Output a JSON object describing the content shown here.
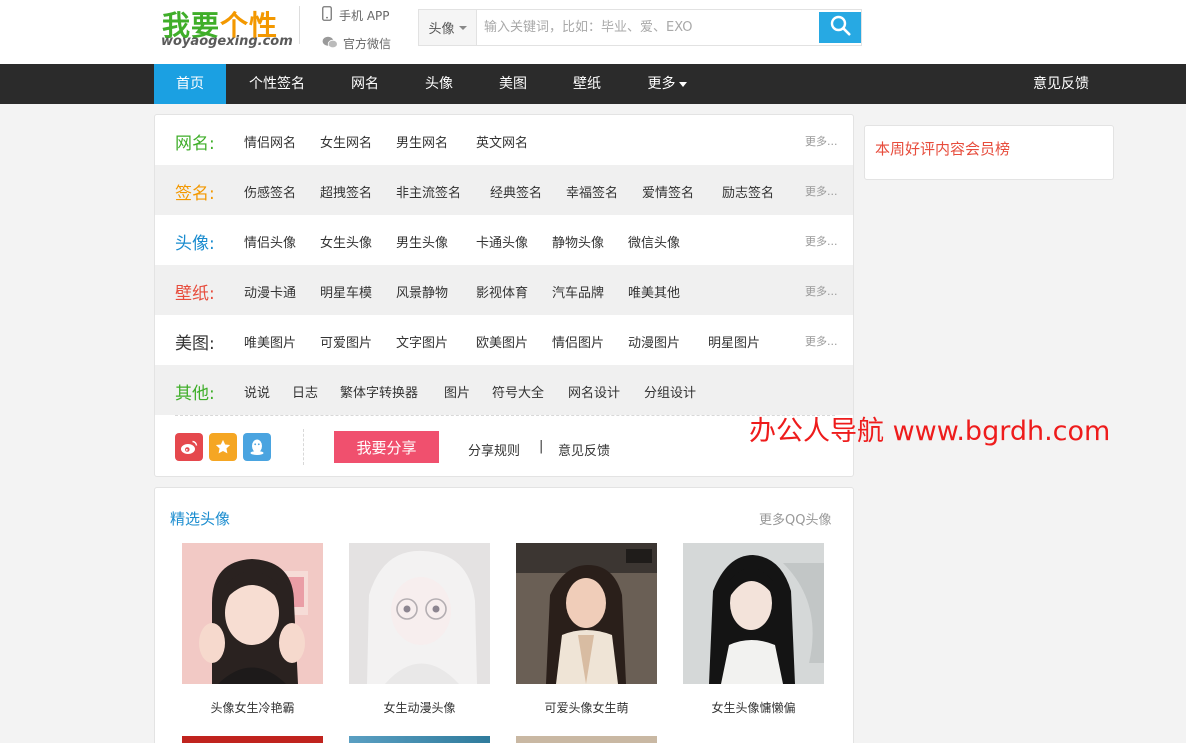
{
  "header": {
    "logo_main_a": "我要",
    "logo_main_b": "个性",
    "logo_sub": "woyaogexing.com",
    "app_link": "手机 APP",
    "wechat_link": "官方微信",
    "search_category": "头像",
    "search_placeholder": "输入关键词，比如：毕业、爱、EXO"
  },
  "nav": {
    "items": [
      {
        "label": "首页"
      },
      {
        "label": "个性签名"
      },
      {
        "label": "网名"
      },
      {
        "label": "头像"
      },
      {
        "label": "美图"
      },
      {
        "label": "壁纸"
      },
      {
        "label": "更多"
      }
    ],
    "feedback": "意见反馈"
  },
  "categories": [
    {
      "title": "网名:",
      "color": "#3fae29",
      "links": [
        "情侣网名",
        "女生网名",
        "男生网名",
        "英文网名"
      ],
      "more": "更多..."
    },
    {
      "title": "签名:",
      "color": "#f39800",
      "links": [
        "伤感签名",
        "超拽签名",
        "非主流签名",
        "经典签名",
        "幸福签名",
        "爱情签名",
        "励志签名"
      ],
      "more": "更多..."
    },
    {
      "title": "头像:",
      "color": "#1a8ccf",
      "links": [
        "情侣头像",
        "女生头像",
        "男生头像",
        "卡通头像",
        "静物头像",
        "微信头像"
      ],
      "more": "更多..."
    },
    {
      "title": "壁纸:",
      "color": "#e74c3c",
      "links": [
        "动漫卡通",
        "明星车模",
        "风景静物",
        "影视体育",
        "汽车品牌",
        "唯美其他"
      ],
      "more": "更多..."
    },
    {
      "title": "美图:",
      "color": "#333333",
      "links": [
        "唯美图片",
        "可爱图片",
        "文字图片",
        "欧美图片",
        "情侣图片",
        "动漫图片",
        "明星图片"
      ],
      "more": "更多..."
    },
    {
      "title": "其他:",
      "color": "#3fae29",
      "links": [
        "说说",
        "日志",
        "繁体字转换器",
        "图片",
        "符号大全",
        "网名设计",
        "分组设计"
      ],
      "more": ""
    }
  ],
  "share": {
    "icons": [
      "weibo-icon",
      "star-icon",
      "qq-icon"
    ],
    "button": "我要分享",
    "rules": "分享规则",
    "separator": "|",
    "feedback": "意见反馈"
  },
  "sidebar": {
    "title": "本周好评内容会员榜"
  },
  "watermark": "办公人导航  www.bgrdh.com",
  "featured": {
    "title": "精选头像",
    "more": "更多QQ头像",
    "items": [
      {
        "caption": "头像女生冷艳霸"
      },
      {
        "caption": "女生动漫头像"
      },
      {
        "caption": "可爱头像女生萌"
      },
      {
        "caption": "女生头像慵懒偏"
      }
    ]
  },
  "colors": {
    "accent": "#1ba0e2",
    "nav_bg": "#2b2b2b",
    "share_button": "#f0506e"
  }
}
